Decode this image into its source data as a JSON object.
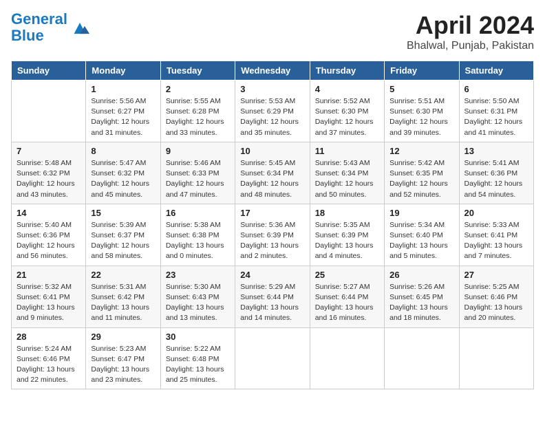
{
  "logo": {
    "line1": "General",
    "line2": "Blue"
  },
  "title": "April 2024",
  "location": "Bhalwal, Punjab, Pakistan",
  "days_of_week": [
    "Sunday",
    "Monday",
    "Tuesday",
    "Wednesday",
    "Thursday",
    "Friday",
    "Saturday"
  ],
  "weeks": [
    [
      {
        "day": "",
        "info": ""
      },
      {
        "day": "1",
        "info": "Sunrise: 5:56 AM\nSunset: 6:27 PM\nDaylight: 12 hours\nand 31 minutes."
      },
      {
        "day": "2",
        "info": "Sunrise: 5:55 AM\nSunset: 6:28 PM\nDaylight: 12 hours\nand 33 minutes."
      },
      {
        "day": "3",
        "info": "Sunrise: 5:53 AM\nSunset: 6:29 PM\nDaylight: 12 hours\nand 35 minutes."
      },
      {
        "day": "4",
        "info": "Sunrise: 5:52 AM\nSunset: 6:30 PM\nDaylight: 12 hours\nand 37 minutes."
      },
      {
        "day": "5",
        "info": "Sunrise: 5:51 AM\nSunset: 6:30 PM\nDaylight: 12 hours\nand 39 minutes."
      },
      {
        "day": "6",
        "info": "Sunrise: 5:50 AM\nSunset: 6:31 PM\nDaylight: 12 hours\nand 41 minutes."
      }
    ],
    [
      {
        "day": "7",
        "info": "Sunrise: 5:48 AM\nSunset: 6:32 PM\nDaylight: 12 hours\nand 43 minutes."
      },
      {
        "day": "8",
        "info": "Sunrise: 5:47 AM\nSunset: 6:32 PM\nDaylight: 12 hours\nand 45 minutes."
      },
      {
        "day": "9",
        "info": "Sunrise: 5:46 AM\nSunset: 6:33 PM\nDaylight: 12 hours\nand 47 minutes."
      },
      {
        "day": "10",
        "info": "Sunrise: 5:45 AM\nSunset: 6:34 PM\nDaylight: 12 hours\nand 48 minutes."
      },
      {
        "day": "11",
        "info": "Sunrise: 5:43 AM\nSunset: 6:34 PM\nDaylight: 12 hours\nand 50 minutes."
      },
      {
        "day": "12",
        "info": "Sunrise: 5:42 AM\nSunset: 6:35 PM\nDaylight: 12 hours\nand 52 minutes."
      },
      {
        "day": "13",
        "info": "Sunrise: 5:41 AM\nSunset: 6:36 PM\nDaylight: 12 hours\nand 54 minutes."
      }
    ],
    [
      {
        "day": "14",
        "info": "Sunrise: 5:40 AM\nSunset: 6:36 PM\nDaylight: 12 hours\nand 56 minutes."
      },
      {
        "day": "15",
        "info": "Sunrise: 5:39 AM\nSunset: 6:37 PM\nDaylight: 12 hours\nand 58 minutes."
      },
      {
        "day": "16",
        "info": "Sunrise: 5:38 AM\nSunset: 6:38 PM\nDaylight: 13 hours\nand 0 minutes."
      },
      {
        "day": "17",
        "info": "Sunrise: 5:36 AM\nSunset: 6:39 PM\nDaylight: 13 hours\nand 2 minutes."
      },
      {
        "day": "18",
        "info": "Sunrise: 5:35 AM\nSunset: 6:39 PM\nDaylight: 13 hours\nand 4 minutes."
      },
      {
        "day": "19",
        "info": "Sunrise: 5:34 AM\nSunset: 6:40 PM\nDaylight: 13 hours\nand 5 minutes."
      },
      {
        "day": "20",
        "info": "Sunrise: 5:33 AM\nSunset: 6:41 PM\nDaylight: 13 hours\nand 7 minutes."
      }
    ],
    [
      {
        "day": "21",
        "info": "Sunrise: 5:32 AM\nSunset: 6:41 PM\nDaylight: 13 hours\nand 9 minutes."
      },
      {
        "day": "22",
        "info": "Sunrise: 5:31 AM\nSunset: 6:42 PM\nDaylight: 13 hours\nand 11 minutes."
      },
      {
        "day": "23",
        "info": "Sunrise: 5:30 AM\nSunset: 6:43 PM\nDaylight: 13 hours\nand 13 minutes."
      },
      {
        "day": "24",
        "info": "Sunrise: 5:29 AM\nSunset: 6:44 PM\nDaylight: 13 hours\nand 14 minutes."
      },
      {
        "day": "25",
        "info": "Sunrise: 5:27 AM\nSunset: 6:44 PM\nDaylight: 13 hours\nand 16 minutes."
      },
      {
        "day": "26",
        "info": "Sunrise: 5:26 AM\nSunset: 6:45 PM\nDaylight: 13 hours\nand 18 minutes."
      },
      {
        "day": "27",
        "info": "Sunrise: 5:25 AM\nSunset: 6:46 PM\nDaylight: 13 hours\nand 20 minutes."
      }
    ],
    [
      {
        "day": "28",
        "info": "Sunrise: 5:24 AM\nSunset: 6:46 PM\nDaylight: 13 hours\nand 22 minutes."
      },
      {
        "day": "29",
        "info": "Sunrise: 5:23 AM\nSunset: 6:47 PM\nDaylight: 13 hours\nand 23 minutes."
      },
      {
        "day": "30",
        "info": "Sunrise: 5:22 AM\nSunset: 6:48 PM\nDaylight: 13 hours\nand 25 minutes."
      },
      {
        "day": "",
        "info": ""
      },
      {
        "day": "",
        "info": ""
      },
      {
        "day": "",
        "info": ""
      },
      {
        "day": "",
        "info": ""
      }
    ]
  ]
}
